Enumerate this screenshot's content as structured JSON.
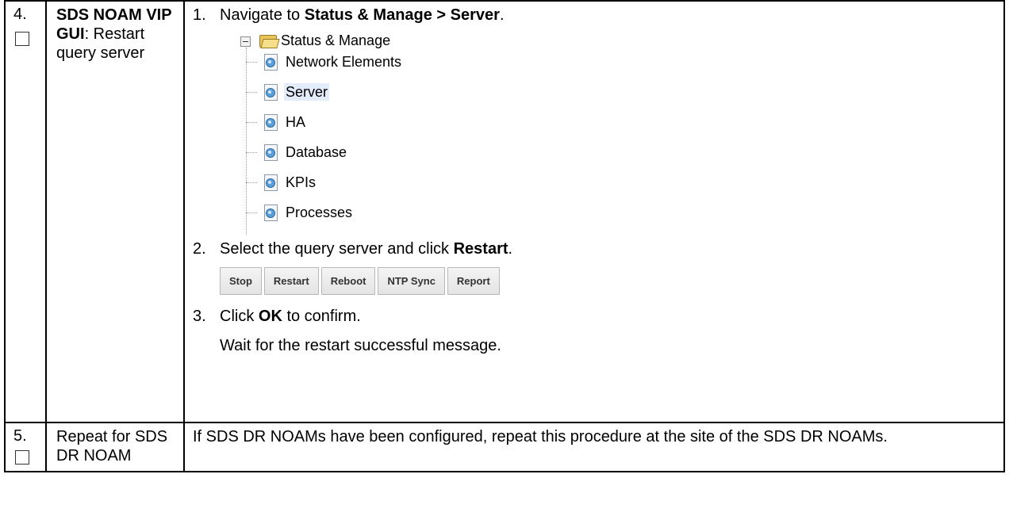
{
  "rows": [
    {
      "step": "4.",
      "title_bold": "SDS NOAM VIP GUI",
      "title_rest": ": Restart query server",
      "instructions": [
        {
          "num": "1.",
          "pre": "Navigate to ",
          "bold": "Status & Manage > Server",
          "post": "."
        },
        {
          "num": "2.",
          "pre": "Select the query server and click ",
          "bold": "Restart",
          "post": "."
        },
        {
          "num": "3.",
          "pre": "Click ",
          "bold": "OK",
          "post": " to confirm."
        }
      ],
      "tree": {
        "root": "Status & Manage",
        "items": [
          "Network Elements",
          "Server",
          "HA",
          "Database",
          "KPIs",
          "Processes"
        ],
        "selected_index": 1
      },
      "buttons": [
        "Stop",
        "Restart",
        "Reboot",
        "NTP Sync",
        "Report"
      ],
      "note": "Wait for the restart successful message."
    },
    {
      "step": "5.",
      "title": "Repeat for SDS DR NOAM",
      "body": "If SDS DR NOAMs have been configured, repeat this procedure at the site of the SDS DR NOAMs."
    }
  ]
}
